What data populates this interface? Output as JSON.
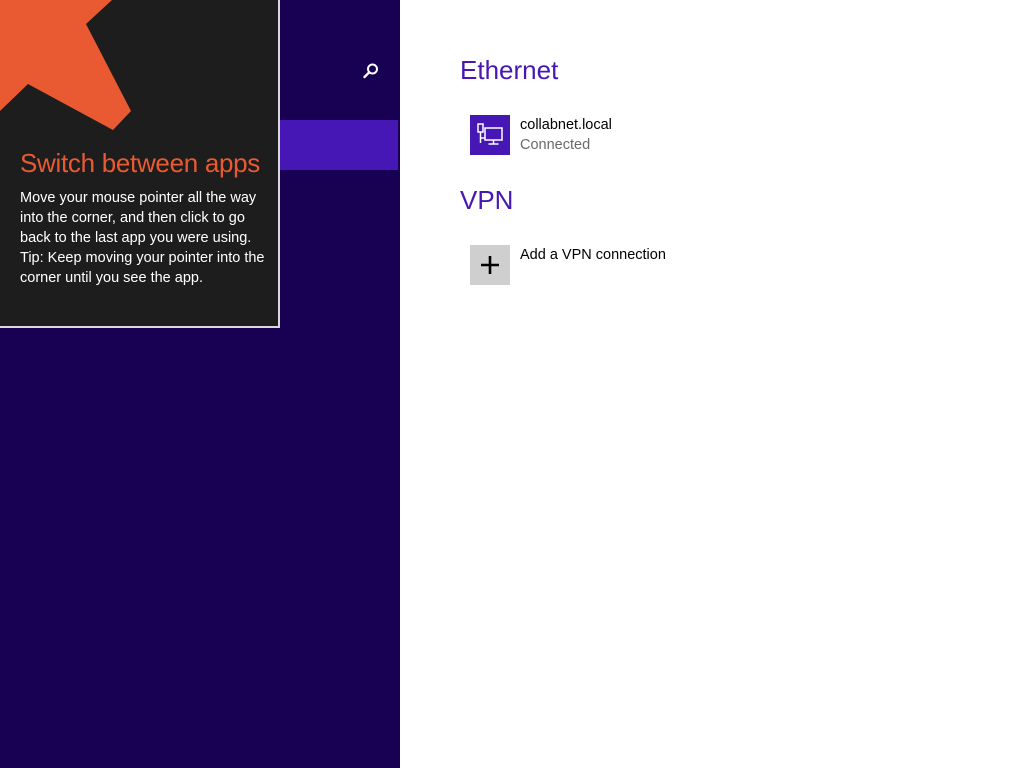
{
  "nav": {
    "background": "#180052",
    "selected_color": "#4617b4",
    "search_icon": "search-icon"
  },
  "tip": {
    "title": "Switch between apps",
    "body_line1": "Move your mouse pointer all the way into the corner, and then click to go back to the last app you were using.",
    "body_line2": "Tip: Keep moving your pointer into the corner until you see the app.",
    "title_color": "#ea5a32",
    "arrow_icon": "corner-arrow-icon"
  },
  "ethernet": {
    "heading": "Ethernet",
    "network_name": "collabnet.local",
    "status": "Connected",
    "icon": "network-monitor-icon"
  },
  "vpn": {
    "heading": "VPN",
    "add_label": "Add a VPN connection",
    "icon": "plus-icon"
  },
  "colors": {
    "accent": "#4617b4"
  }
}
